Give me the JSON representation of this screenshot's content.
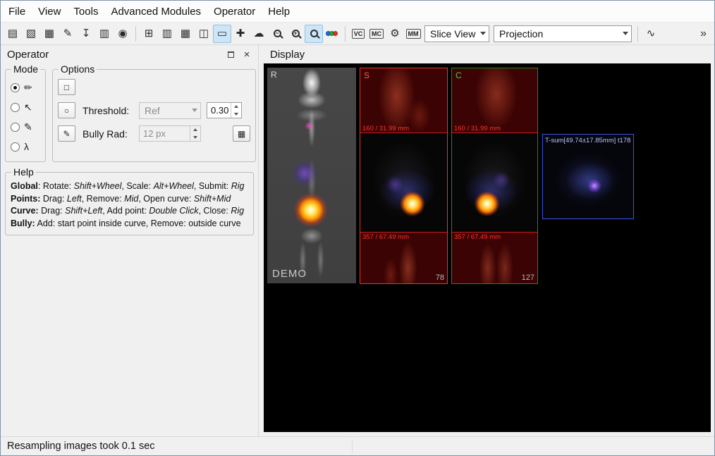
{
  "menubar": {
    "items": [
      {
        "name": "menu-file",
        "label": "File"
      },
      {
        "name": "menu-view",
        "label": "View"
      },
      {
        "name": "menu-tools",
        "label": "Tools"
      },
      {
        "name": "menu-advanced-modules",
        "label": "Advanced Modules"
      },
      {
        "name": "menu-operator",
        "label": "Operator"
      },
      {
        "name": "menu-help",
        "label": "Help"
      }
    ]
  },
  "toolbar": {
    "items": [
      {
        "name": "layers-icon",
        "kind": "glyph",
        "glyph": "▤"
      },
      {
        "name": "volume-icon",
        "kind": "glyph",
        "glyph": "▧"
      },
      {
        "name": "surfaces-icon",
        "kind": "glyph",
        "glyph": "▦"
      },
      {
        "name": "pen-tool-icon",
        "kind": "glyph",
        "glyph": "✎"
      },
      {
        "name": "export-icon",
        "kind": "glyph",
        "glyph": "↧"
      },
      {
        "name": "film-icon",
        "kind": "glyph",
        "glyph": "▥"
      },
      {
        "name": "camera-icon",
        "kind": "glyph",
        "glyph": "◉"
      },
      {
        "kind": "sep"
      },
      {
        "name": "layout-2x2-icon",
        "kind": "glyph",
        "glyph": "⊞"
      },
      {
        "name": "layout-columns-icon",
        "kind": "glyph",
        "glyph": "▥"
      },
      {
        "name": "layout-grid-icon",
        "kind": "glyph",
        "glyph": "▦"
      },
      {
        "name": "layout-split-icon",
        "kind": "glyph",
        "glyph": "◫"
      },
      {
        "name": "layout-single-icon",
        "kind": "glyph",
        "glyph": "▭",
        "checked": true
      },
      {
        "name": "crosshair-icon",
        "kind": "glyph",
        "glyph": "✚"
      },
      {
        "name": "cloud-icon",
        "kind": "glyph",
        "glyph": "☁"
      },
      {
        "name": "zoom-out-icon",
        "kind": "mag",
        "sign": "−"
      },
      {
        "name": "zoom-in-icon",
        "kind": "mag",
        "sign": "+"
      },
      {
        "name": "magnifier-icon",
        "kind": "mag",
        "sign": "",
        "checked": true
      },
      {
        "name": "colors-icon",
        "kind": "dots"
      },
      {
        "kind": "sep"
      },
      {
        "name": "vc-icon",
        "kind": "textico",
        "text": "VC"
      },
      {
        "name": "mc-icon",
        "kind": "textico",
        "text": "MC"
      },
      {
        "name": "registration-gear-icon",
        "kind": "glyph",
        "glyph": "⚙"
      },
      {
        "name": "mm-icon",
        "kind": "textico",
        "text": "MM"
      },
      {
        "name": "slice-view-combo",
        "kind": "combo",
        "text": "Slice View",
        "width": 92
      },
      {
        "name": "projection-combo",
        "kind": "combo",
        "text": "Projection",
        "width": 196
      },
      {
        "kind": "sep"
      },
      {
        "name": "curve-tool-icon",
        "kind": "glyph",
        "glyph": "∿"
      },
      {
        "name": "toolbar-overflow-chevron",
        "kind": "chevron",
        "text": "»"
      }
    ]
  },
  "operator_panel": {
    "title": "Operator",
    "close_glyph": "×",
    "mode": {
      "title": "Mode",
      "items": [
        {
          "name": "mode-draw",
          "glyph": "✏",
          "selected": true
        },
        {
          "name": "mode-move",
          "glyph": "↖",
          "selected": false
        },
        {
          "name": "mode-curve",
          "glyph": "✎",
          "selected": false
        },
        {
          "name": "mode-bully",
          "glyph": "λ",
          "selected": false
        }
      ]
    },
    "options": {
      "title": "Options",
      "buttons": [
        {
          "glyph": "□"
        },
        {
          "glyph": "○"
        },
        {
          "glyph": "✎"
        },
        {
          "glyph": "▦"
        }
      ],
      "threshold_label": "Threshold:",
      "threshold_combo_value": "Ref",
      "threshold_spin_value": "0.30",
      "bully_rad_label": "Bully Rad:",
      "bully_rad_spin_value": "12 px"
    },
    "help": {
      "title": "Help",
      "lines": [
        {
          "segments": [
            {
              "t": "Global",
              "s": "b"
            },
            {
              "t": ": Rotate: ",
              "s": ""
            },
            {
              "t": "Shift+Wheel",
              "s": "i"
            },
            {
              "t": ", Scale: ",
              "s": ""
            },
            {
              "t": "Alt+Wheel",
              "s": "i"
            },
            {
              "t": ", Submit: ",
              "s": ""
            },
            {
              "t": "Rig",
              "s": "i"
            }
          ]
        },
        {
          "segments": [
            {
              "t": "Points:",
              "s": "b"
            },
            {
              "t": " Drag: ",
              "s": ""
            },
            {
              "t": "Left",
              "s": "i"
            },
            {
              "t": ", Remove: ",
              "s": ""
            },
            {
              "t": "Mid",
              "s": "i"
            },
            {
              "t": ", Open curve: ",
              "s": ""
            },
            {
              "t": "Shift+Mid",
              "s": "i"
            }
          ]
        },
        {
          "segments": [
            {
              "t": "Curve:",
              "s": "b"
            },
            {
              "t": " Drag: ",
              "s": ""
            },
            {
              "t": "Shift+Left",
              "s": "i"
            },
            {
              "t": ", Add point: ",
              "s": ""
            },
            {
              "t": "Double Click",
              "s": "i"
            },
            {
              "t": ", Close: ",
              "s": ""
            },
            {
              "t": "Rig",
              "s": "i"
            }
          ]
        },
        {
          "segments": [
            {
              "t": "Bully:",
              "s": "b"
            },
            {
              "t": " Add: start point inside curve, Remove: outside curve",
              "s": ""
            }
          ]
        }
      ]
    }
  },
  "display_panel": {
    "title": "Display",
    "views": {
      "mip": {
        "label": "R",
        "watermark": "DEMO"
      },
      "sagittal": {
        "label": "S",
        "top_measure": "160 / 31.99 mm",
        "bottom_measure": "357 / 67.49 mm",
        "slice_number": "78"
      },
      "coronal": {
        "label": "C",
        "top_measure": "160 / 31.99 mm",
        "bottom_measure": "357 / 67.49 mm",
        "slice_number": "127"
      },
      "axial": {
        "label": "T-sum[49.74±17.85mm] t178"
      }
    }
  },
  "statusbar": {
    "message": "Resampling images took 0.1 sec"
  },
  "colors": {
    "toolbar_selection": "#cde6f7",
    "view_border_red": "#e23a2e",
    "view_border_green": "#1e8a1e",
    "view_border_blue": "#3b55e6",
    "slab_overlay_red": "rgba(125,0,0,0.45)",
    "measure_text_red": "#ff3434",
    "hotspot_yellow": "#ffd84d"
  }
}
